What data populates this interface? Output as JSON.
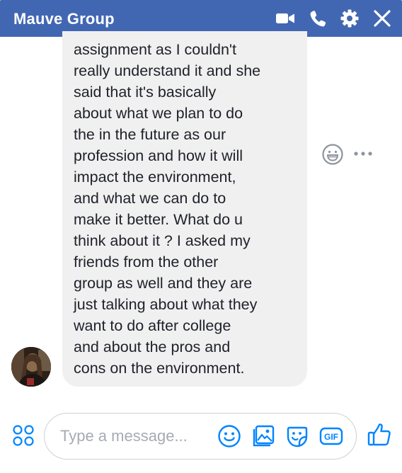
{
  "header": {
    "title": "Mauve Group",
    "icons": [
      "video-camera-icon",
      "phone-icon",
      "gear-icon",
      "close-icon"
    ]
  },
  "message": {
    "lines": [
      "assignment as I couldn't",
      "really understand it and she",
      "said that it's basically",
      "about what we plan to do",
      "the in the future as our",
      "profession and how it will",
      "impact the environment,",
      "and what we can do to",
      "make it better. What do u",
      "think about it ? I asked my",
      "friends from the other",
      "group as well and they are",
      "just talking about what they",
      "want to do after college",
      "and about the pros and",
      "cons on the environment."
    ]
  },
  "composer": {
    "placeholder": "Type a message...",
    "gif_label": "GIF"
  },
  "colors": {
    "brand": "#4267b2",
    "accent": "#0084ff",
    "bubble": "#f1f0f0",
    "text": "#1d2129",
    "placeholder": "#a5abb3"
  }
}
